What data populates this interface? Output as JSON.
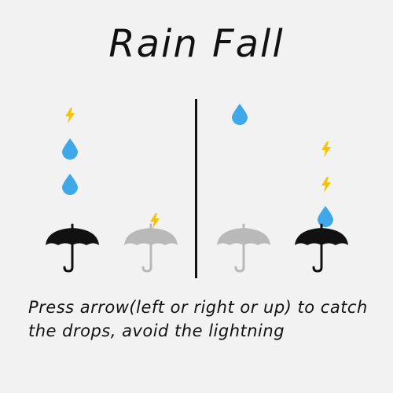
{
  "game": {
    "title": "Rain Fall",
    "instructions": "Press arrow(left or right or up) to catch the drops, avoid the lightning",
    "colors": {
      "background": "#f2f2f2",
      "drop": "#3ea8e8",
      "lightning": "#f5c400",
      "umbrella_active": "#111111",
      "umbrella_inactive": "#b9b9b9",
      "text": "#111111"
    },
    "lanes": [
      {
        "side": "left",
        "lane": 1,
        "umbrella": "active"
      },
      {
        "side": "left",
        "lane": 2,
        "umbrella": "inactive"
      },
      {
        "side": "right",
        "lane": 1,
        "umbrella": "inactive"
      },
      {
        "side": "right",
        "lane": 2,
        "umbrella": "active"
      }
    ],
    "falling_items": [
      {
        "type": "lightning",
        "icon": "lightning-icon",
        "lane": "left-1"
      },
      {
        "type": "drop",
        "icon": "raindrop-icon",
        "lane": "left-1"
      },
      {
        "type": "drop",
        "icon": "raindrop-icon",
        "lane": "left-1"
      },
      {
        "type": "lightning",
        "icon": "lightning-icon",
        "lane": "left-2"
      },
      {
        "type": "drop",
        "icon": "raindrop-icon",
        "lane": "right-1"
      },
      {
        "type": "lightning",
        "icon": "lightning-icon",
        "lane": "right-2"
      },
      {
        "type": "lightning",
        "icon": "lightning-icon",
        "lane": "right-2"
      },
      {
        "type": "drop",
        "icon": "raindrop-icon",
        "lane": "right-2"
      }
    ]
  }
}
